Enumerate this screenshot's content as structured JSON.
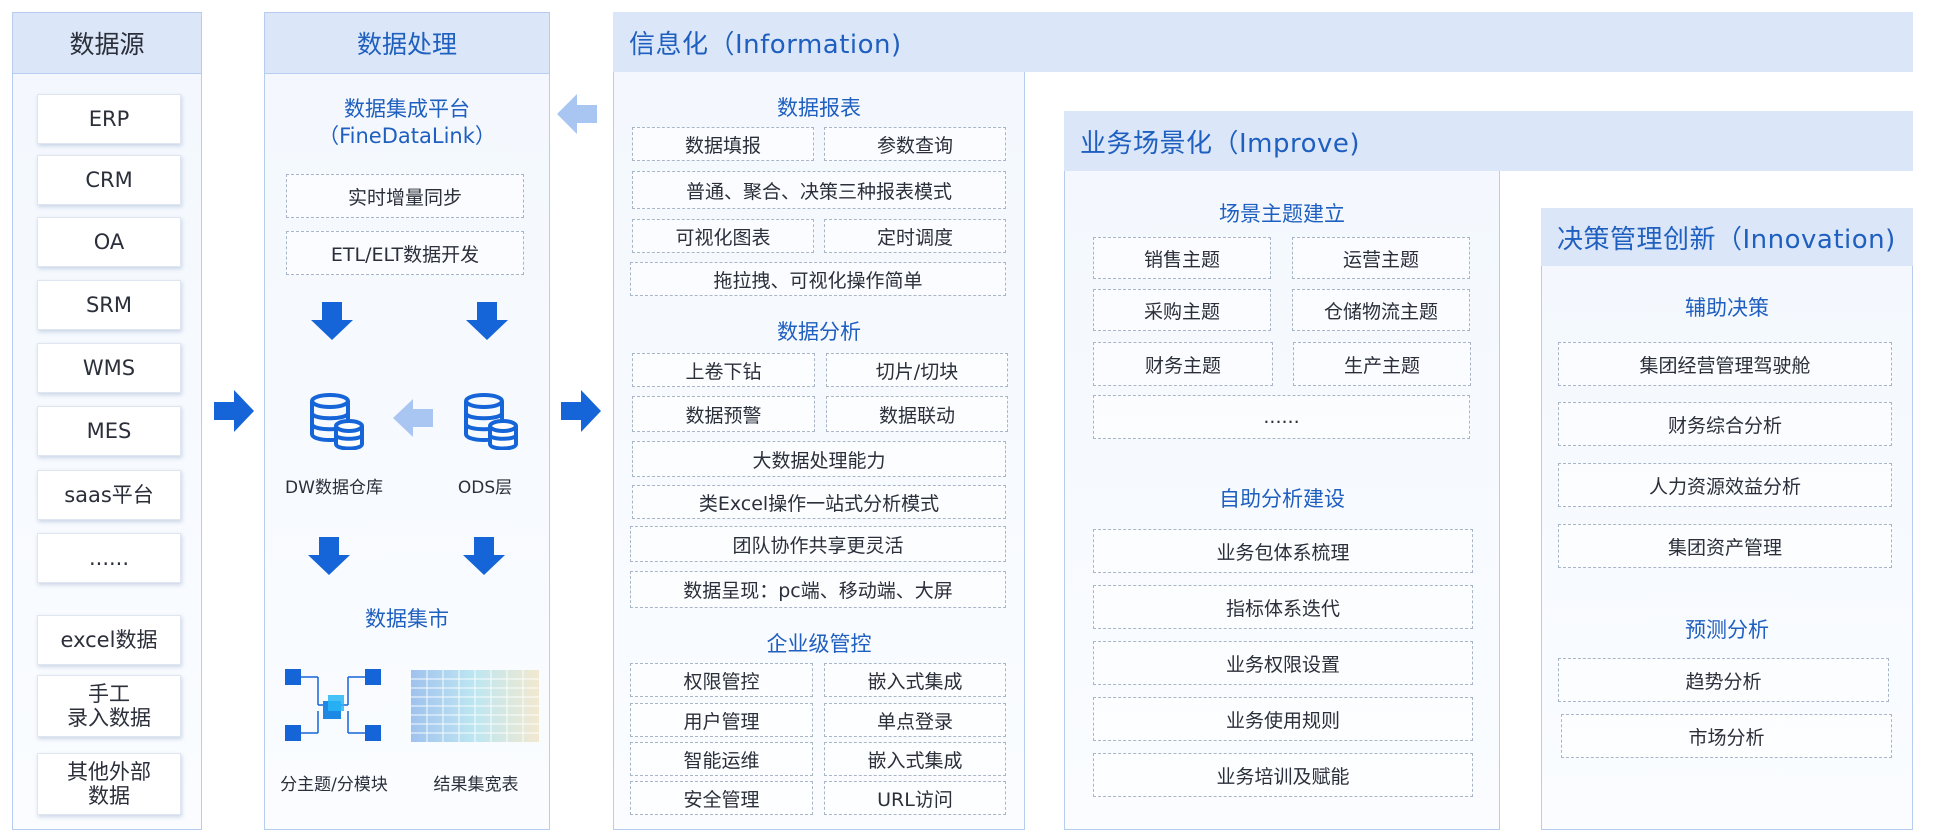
{
  "sources": {
    "title": "数据源",
    "items": [
      "ERP",
      "CRM",
      "OA",
      "SRM",
      "WMS",
      "MES",
      "saas平台",
      "......",
      "excel数据",
      "手工\n录入数据",
      "其他外部\n数据"
    ]
  },
  "processing": {
    "title": "数据处理",
    "platform_title_line1": "数据集成平台",
    "platform_title_line2": "（FineDataLink）",
    "sync": "实时增量同步",
    "etl": "ETL/ELT数据开发",
    "dw_label": "DW数据仓库",
    "ods_label": "ODS层",
    "mart_title": "数据集市",
    "subject_label": "分主题/分模块",
    "result_label": "结果集宽表"
  },
  "information": {
    "title": "信息化（Information)",
    "reports": {
      "title": "数据报表",
      "items": [
        "数据填报",
        "参数查询",
        "普通、聚合、决策三种报表模式",
        "可视化图表",
        "定时调度",
        "拖拉拽、可视化操作简单"
      ]
    },
    "analysis": {
      "title": "数据分析",
      "items": [
        "上卷下钻",
        "切片/切块",
        "数据预警",
        "数据联动",
        "大数据处理能力",
        "类Excel操作一站式分析模式",
        "团队协作共享更灵活",
        "数据呈现：pc端、移动端、大屏"
      ]
    },
    "governance": {
      "title": "企业级管控",
      "items": [
        "权限管控",
        "嵌入式集成",
        "用户管理",
        "单点登录",
        "智能运维",
        "嵌入式集成",
        "安全管理",
        "URL访问"
      ]
    }
  },
  "improve": {
    "title": "业务场景化（Improve)",
    "scenes": {
      "title": "场景主题建立",
      "items": [
        "销售主题",
        "运营主题",
        "采购主题",
        "仓储物流主题",
        "财务主题",
        "生产主题",
        "......"
      ]
    },
    "self_service": {
      "title": "自助分析建设",
      "items": [
        "业务包体系梳理",
        "指标体系迭代",
        "业务权限设置",
        "业务使用规则",
        "业务培训及赋能"
      ]
    }
  },
  "innovation": {
    "title": "决策管理创新（Innovation)",
    "decision": {
      "title": "辅助决策",
      "items": [
        "集团经营管理驾驶舱",
        "财务综合分析",
        "人力资源效益分析",
        "集团资产管理"
      ]
    },
    "forecast": {
      "title": "预测分析",
      "items": [
        "趋势分析",
        "市场分析"
      ]
    }
  },
  "colors": {
    "accent": "#1f5fbf",
    "arrow": "#1565d8",
    "arrow_light": "#a9c6f2",
    "header_bg": "#dbe7f8",
    "border": "#b6cdef"
  }
}
